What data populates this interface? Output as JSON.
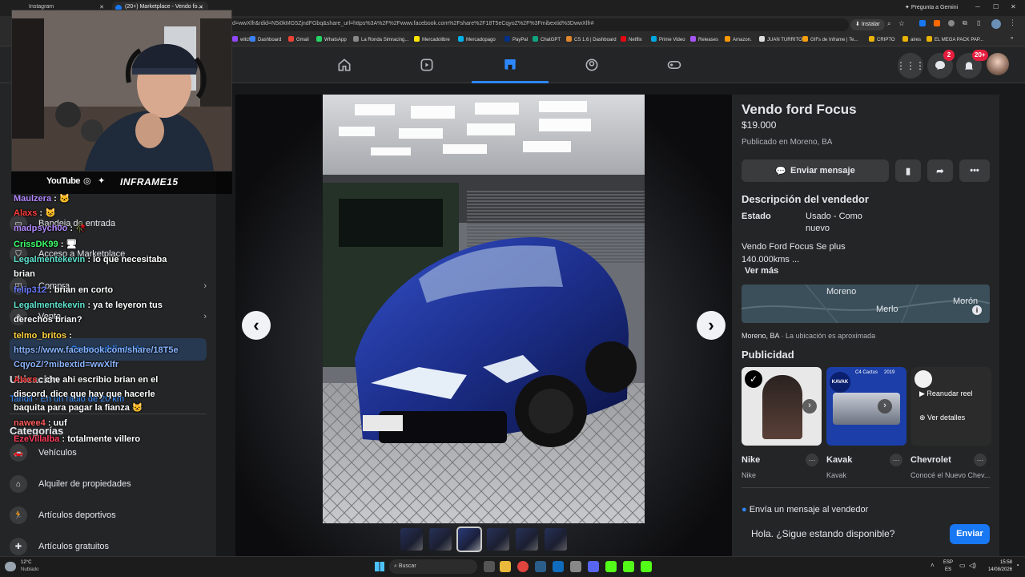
{
  "browser": {
    "tabs": [
      {
        "label": "Instagram"
      },
      {
        "label": "(20+) Marketplace - Vendo fo..."
      }
    ],
    "url": "d=wwXlfr&rdid=N5i0kMG5ZjndFGbq&share_url=https%3A%2F%2Fwww.facebook.com%2Fshare%2F18T5eCqyoZ%2F%3Fmibextid%3DwwXlfr#",
    "install_label": "Instalar",
    "gemini_label": "Pregunta a Gemini",
    "bookmarks": [
      {
        "label": "witch",
        "color": "#9146ff"
      },
      {
        "label": "Dashboard",
        "color": "#3b82f6"
      },
      {
        "label": "Gmail",
        "color": "#ea4335"
      },
      {
        "label": "WhatsApp",
        "color": "#25d366"
      },
      {
        "label": "La Ronda Simracing...",
        "color": "#888888"
      },
      {
        "label": "Mercadolibre",
        "color": "#ffe600"
      },
      {
        "label": "Mercadopago",
        "color": "#00b1ea"
      },
      {
        "label": "PayPal",
        "color": "#003087"
      },
      {
        "label": "ChatGPT",
        "color": "#10a37f"
      },
      {
        "label": "CS 1.6 | Dashboard",
        "color": "#e0862b"
      },
      {
        "label": "Netflix",
        "color": "#e50914"
      },
      {
        "label": "Prime Video",
        "color": "#00a8e1"
      },
      {
        "label": "Releases",
        "color": "#a855f7"
      },
      {
        "label": "Amazon.",
        "color": "#ff9900"
      },
      {
        "label": "JUAN TURRITO",
        "color": "#dddddd"
      },
      {
        "label": "GIFs de Inframe | Te...",
        "color": "#f59e0b"
      },
      {
        "label": "CRIPTO",
        "color": "#eab308"
      },
      {
        "label": "aires",
        "color": "#eab308"
      },
      {
        "label": "EL MEGA PACK PAP...",
        "color": "#eab308"
      }
    ]
  },
  "header": {
    "messenger_badge": "2",
    "notifications_badge": "20+"
  },
  "webcam": {
    "youtube_label": "YouTube",
    "handle": "INFRAME15"
  },
  "sidebar": {
    "items": [
      {
        "label": "Bandeja de entrada"
      },
      {
        "label": "Acceso a Marketplace"
      },
      {
        "label": "Compra"
      },
      {
        "label": "Venta"
      }
    ],
    "create_listing": "Crear publicación",
    "location_heading": "Ubicación",
    "location_value": "Tandil · En un radio de 20 km",
    "categories_heading": "Categorías",
    "categories": [
      {
        "label": "Vehículos"
      },
      {
        "label": "Alquiler de propiedades"
      },
      {
        "label": "Artículos deportivos"
      },
      {
        "label": "Artículos gratuitos"
      }
    ]
  },
  "chat": [
    {
      "user": "Maulzera",
      "color": "#b388ff",
      "text": ": 🐱"
    },
    {
      "user": "Alaxs",
      "color": "#ff3b3b",
      "text": ": 😺"
    },
    {
      "user": "madpsych0o",
      "color": "#b388ff",
      "text": ": 🥀"
    },
    {
      "user": "CrissDK99",
      "color": "#3cff6b",
      "text": ": 🖥"
    },
    {
      "user": "Legalmentekevin",
      "color": "#5fe3d0",
      "text": ": lo que necesitaba"
    },
    {
      "user": "",
      "color": "#ffffff",
      "text": "brian"
    },
    {
      "user": "felip312",
      "color": "#6b7cff",
      "text": ": brian en corto"
    },
    {
      "user": "Legalmentekevin",
      "color": "#5fe3d0",
      "text": ": ya te leyeron tus"
    },
    {
      "user": "",
      "color": "#ffffff",
      "text": "derechos brian?"
    },
    {
      "user": "telmo_britos",
      "color": "#ffd23f",
      "text": ":"
    },
    {
      "user": "",
      "color": "#8ab4ff",
      "text": "https://www.facebook.com/share/18T5e"
    },
    {
      "user": "",
      "color": "#8ab4ff",
      "text": "CqyoZ/?mibextid=wwXlfr"
    },
    {
      "user": "Alaxs",
      "color": "#ff3b3b",
      "text": ": che ahi escribio brian en el"
    },
    {
      "user": "",
      "color": "#ffffff",
      "text": "discord, dice que hay que hacerle"
    },
    {
      "user": "",
      "color": "#ffffff",
      "text": "baquita para pagar la fianza 😺"
    },
    {
      "user": "nawee4",
      "color": "#ff5c5c",
      "text": ": uuf"
    },
    {
      "user": "EzeVillalba",
      "color": "#ff3b5c",
      "text": ": totalmente villero"
    }
  ],
  "listing": {
    "title": "Vendo ford Focus",
    "price": "$19.000",
    "published": "Publicado en Moreno, BA",
    "send_message": "Enviar mensaje",
    "seller_description_heading": "Descripción del vendedor",
    "condition_label": "Estado",
    "condition_value_1": "Usado - Como",
    "condition_value_2": "nuevo",
    "description_1": "Vendo Ford Focus Se plus",
    "description_2": "140.000kms ...",
    "see_more": "Ver más",
    "map_labels": {
      "moreno": "Moreno",
      "merlo": "Merlo",
      "moron": "Morón"
    },
    "location_line": "Moreno, BA",
    "location_note": " · La ubicación es aproximada",
    "ads_heading": "Publicidad",
    "ads": [
      {
        "name": "Nike",
        "sub": "Nike"
      },
      {
        "name": "Kavak",
        "sub": "Kavak",
        "card_label": "KAVAK",
        "card_model": "C4 Cactus",
        "card_year": "2019"
      },
      {
        "name": "Chevrolet",
        "sub": "Conocé el Nuevo Chev...",
        "replay": "Reanudar reel",
        "details": "Ver detalles"
      }
    ],
    "send_seller_heading": "Envía un mensaje al vendedor",
    "message_text": "Hola. ¿Sigue estando disponible?",
    "send_button": "Enviar"
  },
  "taskbar": {
    "weather_temp": "12°C",
    "weather_desc": "Nublado",
    "search_label": "Buscar",
    "lang_1": "ESP",
    "lang_2": "ES",
    "time": "15:58",
    "date": "14/08/2026"
  }
}
